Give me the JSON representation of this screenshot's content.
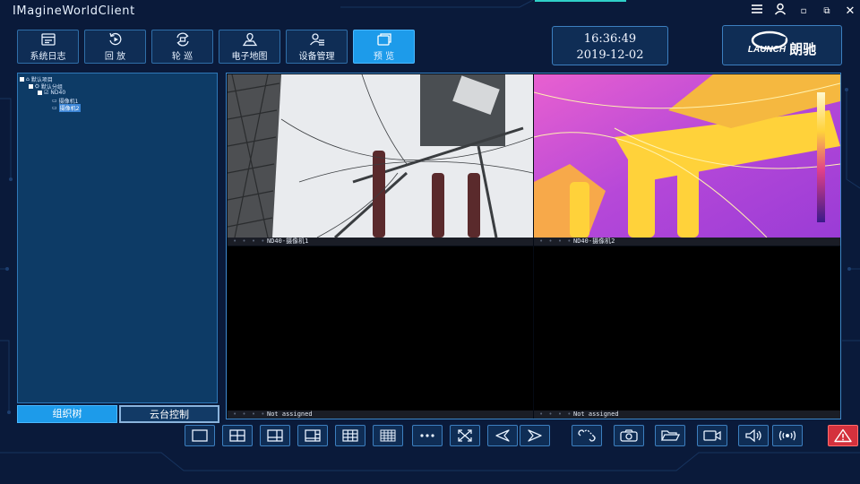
{
  "window": {
    "title": "IMagineWorldClient",
    "controls": {
      "minimize": "▫",
      "maximize": "⧉",
      "close": "✕"
    }
  },
  "nav": {
    "items": [
      {
        "label": "系统日志",
        "icon": "log-icon"
      },
      {
        "label": "回 放",
        "icon": "playback-icon"
      },
      {
        "label": "轮 巡",
        "icon": "patrol-icon"
      },
      {
        "label": "电子地图",
        "icon": "map-icon"
      },
      {
        "label": "设备管理",
        "icon": "device-manage-icon"
      },
      {
        "label": "预 览",
        "icon": "preview-icon",
        "active": true
      }
    ]
  },
  "clock": {
    "time": "16:36:49",
    "date": "2019-12-02"
  },
  "logo": {
    "brand": "LAUNCH",
    "cn": "朗驰"
  },
  "tree": {
    "root": "默认项目",
    "group": "默认分组",
    "device": "ND40",
    "cameras": [
      "摄像机1",
      "摄像机2"
    ]
  },
  "left_tabs": {
    "org_tree": "组织树",
    "ptz": "云台控制"
  },
  "video": {
    "cells": [
      {
        "label": "ND40-摄像机1",
        "type": "visible"
      },
      {
        "label": "ND40-摄像机2",
        "type": "thermal"
      },
      {
        "label": "Not assigned",
        "type": "empty"
      },
      {
        "label": "Not assigned",
        "type": "empty"
      }
    ],
    "bar_dots": "• • • •"
  },
  "colors": {
    "accent": "#1d9bea",
    "panel": "#0d3b66",
    "alarm": "#d4313d",
    "background": "#0a1a3a"
  }
}
